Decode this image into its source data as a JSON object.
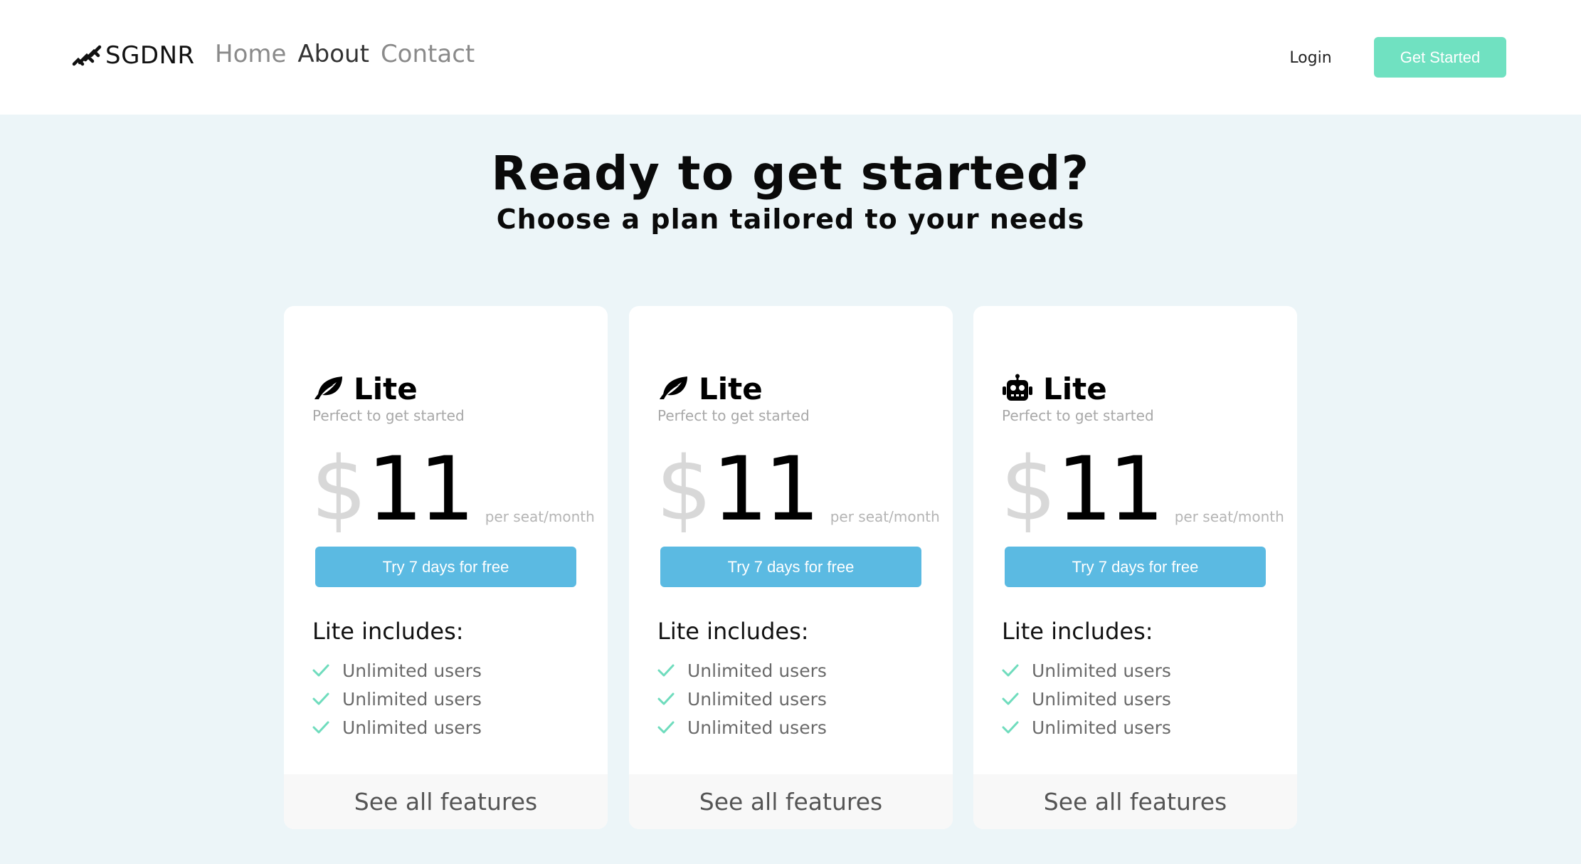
{
  "header": {
    "logo_text": "SGDNR",
    "nav": [
      "Home",
      "About",
      "Contact"
    ],
    "active_nav": "About",
    "login_label": "Login",
    "cta_label": "Get Started"
  },
  "hero": {
    "title": "Ready to get started?",
    "subtitle": "Choose a plan tailored to your needs"
  },
  "plans": [
    {
      "icon": "leaf-icon",
      "name": "Lite",
      "tagline": "Perfect to get started",
      "currency": "$",
      "price": "11",
      "period": "per seat/month",
      "button": "Try 7 days for free",
      "includes_title": "Lite includes:",
      "features": [
        "Unlimited users",
        "Unlimited users",
        "Unlimited users"
      ],
      "footer": "See all features"
    },
    {
      "icon": "leaf-icon",
      "name": "Lite",
      "tagline": "Perfect to get started",
      "currency": "$",
      "price": "11",
      "period": "per seat/month",
      "button": "Try 7 days for free",
      "includes_title": "Lite includes:",
      "features": [
        "Unlimited users",
        "Unlimited users",
        "Unlimited users"
      ],
      "footer": "See all features"
    },
    {
      "icon": "robot-icon",
      "name": "Lite",
      "tagline": "Perfect to get started",
      "currency": "$",
      "price": "11",
      "period": "per seat/month",
      "button": "Try 7 days for free",
      "includes_title": "Lite includes:",
      "features": [
        "Unlimited users",
        "Unlimited users",
        "Unlimited users"
      ],
      "footer": "See all features"
    }
  ],
  "colors": {
    "page_bg": "#ecf5f8",
    "cta": "#70e1c1",
    "trial_button": "#5bbae2",
    "check": "#6fdcbd"
  }
}
